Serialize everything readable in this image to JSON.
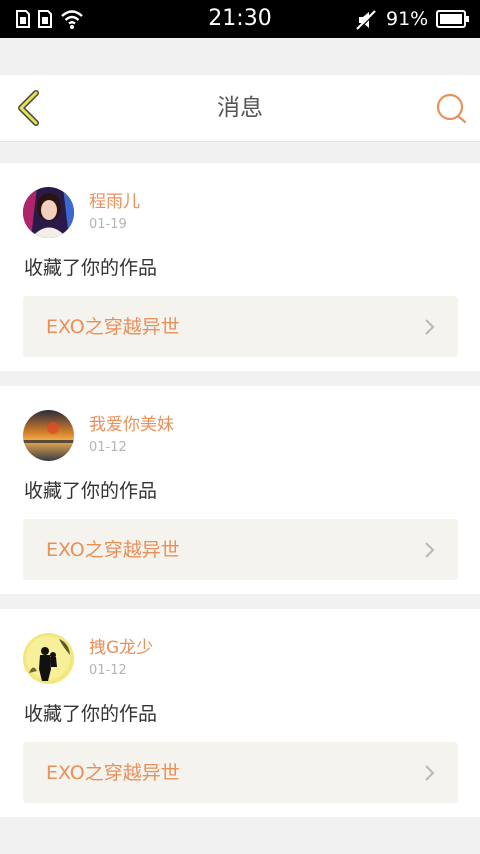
{
  "status_bar": {
    "time": "21:30",
    "battery": "91%"
  },
  "header": {
    "title": "消息",
    "accent_color": "#e8905a"
  },
  "messages": [
    {
      "name": "程雨儿",
      "date": "01-19",
      "action": "收藏了你的作品",
      "work": "EXO之穿越异世"
    },
    {
      "name": "我爱你美妹",
      "date": "01-12",
      "action": "收藏了你的作品",
      "work": "EXO之穿越异世"
    },
    {
      "name": "拽G龙少",
      "date": "01-12",
      "action": "收藏了你的作品",
      "work": "EXO之穿越异世"
    }
  ]
}
